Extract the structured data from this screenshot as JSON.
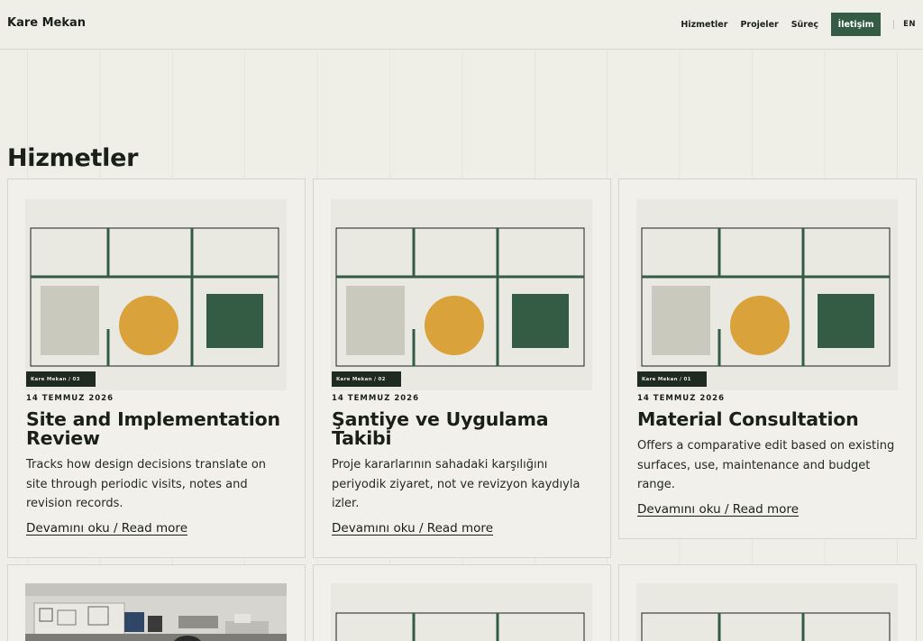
{
  "header": {
    "brand": "Kare Mekan",
    "nav": [
      "Hizmetler",
      "Projeler",
      "Süreç"
    ],
    "cta": "İletişim",
    "lang": "EN"
  },
  "page": {
    "title": "Hizmetler"
  },
  "cards": [
    {
      "tag": "Kare Mekan / 03",
      "date": "14 TEMMUZ 2026",
      "title": "Site and Implementation Review",
      "desc": "Tracks how design decisions translate on site through periodic visits, notes and revision records.",
      "more": "Devamını oku / Read more"
    },
    {
      "tag": "Kare Mekan / 02",
      "date": "14 TEMMUZ 2026",
      "title": "Şantiye ve Uygulama Takibi",
      "desc": "Proje kararlarının sahadaki karşılığını periyodik ziyaret, not ve revizyon kaydıyla izler.",
      "more": "Devamını oku / Read more"
    },
    {
      "tag": "Kare Mekan / 01",
      "date": "14 TEMMUZ 2026",
      "title": "Material Consultation",
      "desc": "Offers a comparative edit based on existing surfaces, use, maintenance and budget range.",
      "more": "Devamını oku / Read more"
    }
  ],
  "colors": {
    "accent": "#345c45",
    "yellow": "#d9a23a",
    "stone": "#c9cabd",
    "ink": "#1b1f1a",
    "background": "#efeee7"
  }
}
